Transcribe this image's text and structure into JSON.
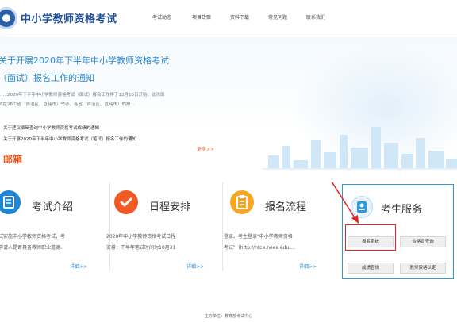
{
  "header": {
    "site_title": "中小学教师资格考试",
    "nav": [
      "考试动态",
      "项目政策",
      "资料下载",
      "常见问题",
      "联系我们"
    ]
  },
  "banner": {
    "news_title_line1": "关于开展2020年下半年中小学教师资格考试",
    "news_title_line2": "（面试）报名工作的通知",
    "summary_line1": "……2020年下半年中小学教师资格考试（面试）报名工作将于12月10日开始，此次面",
    "summary_line2": "试在28个省（自治区、直辖市）举办，各省（自治区、直辖市）的报...",
    "links": [
      "关于建议编辑查询中小学教师资格考试成绩的通知",
      "关于开展2020年下半年中小学教师资格考试（笔试）报名工作的通知"
    ],
    "more": "更多>>",
    "stamp_word": "邮箱"
  },
  "cards": [
    {
      "title": "考试介绍",
      "text_line1": "试实施中小学教师资格考试，考",
      "text_line2": "申请人是否具备教师职业道德、",
      "more": "详细>>"
    },
    {
      "title": "日程安排",
      "text_line1": "2020年中小学教师资格考试日程",
      "text_line2": "安排：下半年笔试时间为10月31",
      "more": "详细>>"
    },
    {
      "title": "报名流程",
      "text_line1": "登录。考生登录\"中小学教师资格",
      "text_line2": "考试\"（http://ntce.neea.edu....",
      "more": "详细>>"
    }
  ],
  "service": {
    "title": "考生服务",
    "buttons": [
      "报名系统",
      "合格证查询",
      "成绩查询",
      "教师资格认定"
    ]
  },
  "footer": {
    "text": "主办单位：教育部考试中心"
  },
  "colors": {
    "brand_blue": "#23529d",
    "accent_blue": "#2a8bd1",
    "accent_orange": "#e8541e",
    "highlight_red": "#e02424"
  }
}
